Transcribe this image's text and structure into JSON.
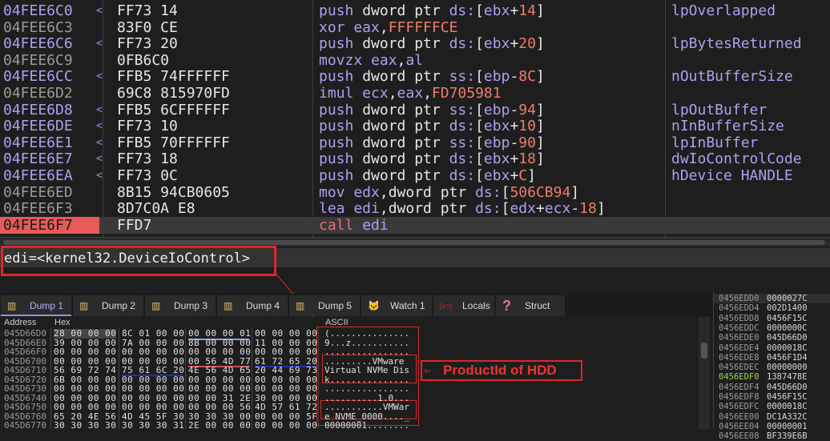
{
  "disasm": [
    {
      "addr": "04FEE6C0",
      "jt": true,
      "bytes": "FF73 14",
      "ins": [
        [
          "m",
          "push "
        ],
        [
          "w",
          "dword ptr "
        ],
        [
          "m",
          "ds:"
        ],
        [
          "w",
          "["
        ],
        [
          "m",
          "ebx"
        ],
        [
          "w",
          "+"
        ],
        [
          "n",
          "14"
        ],
        [
          "w",
          "]"
        ]
      ],
      "comment": "lpOverlapped"
    },
    {
      "addr": "04FEE6C3",
      "jt": false,
      "bytes": "83F0 CE",
      "ins": [
        [
          "m",
          "xor eax"
        ],
        [
          "w",
          ","
        ],
        [
          "n",
          "FFFFFFCE"
        ]
      ],
      "comment": ""
    },
    {
      "addr": "04FEE6C6",
      "jt": true,
      "bytes": "FF73 20",
      "ins": [
        [
          "m",
          "push "
        ],
        [
          "w",
          "dword ptr "
        ],
        [
          "m",
          "ds:"
        ],
        [
          "w",
          "["
        ],
        [
          "m",
          "ebx"
        ],
        [
          "w",
          "+"
        ],
        [
          "n",
          "20"
        ],
        [
          "w",
          "]"
        ]
      ],
      "comment": "lpBytesReturned"
    },
    {
      "addr": "04FEE6C9",
      "jt": false,
      "bytes": "0FB6C0",
      "ins": [
        [
          "m",
          "movzx eax"
        ],
        [
          "w",
          ","
        ],
        [
          "m",
          "al"
        ]
      ],
      "comment": ""
    },
    {
      "addr": "04FEE6CC",
      "jt": true,
      "bytes": "FFB5 74FFFFFF",
      "ins": [
        [
          "m",
          "push "
        ],
        [
          "w",
          "dword ptr "
        ],
        [
          "m",
          "ss:"
        ],
        [
          "w",
          "["
        ],
        [
          "m",
          "ebp"
        ],
        [
          "w",
          "-"
        ],
        [
          "n",
          "8C"
        ],
        [
          "w",
          "]"
        ]
      ],
      "comment": "nOutBufferSize"
    },
    {
      "addr": "04FEE6D2",
      "jt": false,
      "bytes": "69C8 815970FD",
      "ins": [
        [
          "m",
          "imul ecx"
        ],
        [
          "w",
          ","
        ],
        [
          "m",
          "eax"
        ],
        [
          "w",
          ","
        ],
        [
          "n",
          "FD705981"
        ]
      ],
      "comment": ""
    },
    {
      "addr": "04FEE6D8",
      "jt": true,
      "bytes": "FFB5 6CFFFFFF",
      "ins": [
        [
          "m",
          "push "
        ],
        [
          "w",
          "dword ptr "
        ],
        [
          "m",
          "ss:"
        ],
        [
          "w",
          "["
        ],
        [
          "m",
          "ebp"
        ],
        [
          "w",
          "-"
        ],
        [
          "n",
          "94"
        ],
        [
          "w",
          "]"
        ]
      ],
      "comment": "lpOutBuffer"
    },
    {
      "addr": "04FEE6DE",
      "jt": true,
      "bytes": "FF73 10",
      "ins": [
        [
          "m",
          "push "
        ],
        [
          "w",
          "dword ptr "
        ],
        [
          "m",
          "ds:"
        ],
        [
          "w",
          "["
        ],
        [
          "m",
          "ebx"
        ],
        [
          "w",
          "+"
        ],
        [
          "n",
          "10"
        ],
        [
          "w",
          "]"
        ]
      ],
      "comment": "nInBufferSize"
    },
    {
      "addr": "04FEE6E1",
      "jt": true,
      "bytes": "FFB5 70FFFFFF",
      "ins": [
        [
          "m",
          "push "
        ],
        [
          "w",
          "dword ptr "
        ],
        [
          "m",
          "ss:"
        ],
        [
          "w",
          "["
        ],
        [
          "m",
          "ebp"
        ],
        [
          "w",
          "-"
        ],
        [
          "n",
          "90"
        ],
        [
          "w",
          "]"
        ]
      ],
      "comment": "lpInBuffer"
    },
    {
      "addr": "04FEE6E7",
      "jt": true,
      "bytes": "FF73 18",
      "ins": [
        [
          "m",
          "push "
        ],
        [
          "w",
          "dword ptr "
        ],
        [
          "m",
          "ds:"
        ],
        [
          "w",
          "["
        ],
        [
          "m",
          "ebx"
        ],
        [
          "w",
          "+"
        ],
        [
          "n",
          "18"
        ],
        [
          "w",
          "]"
        ]
      ],
      "comment": "dwIoControlCode"
    },
    {
      "addr": "04FEE6EA",
      "jt": true,
      "bytes": "FF73 0C",
      "ins": [
        [
          "m",
          "push "
        ],
        [
          "w",
          "dword ptr "
        ],
        [
          "m",
          "ds:"
        ],
        [
          "w",
          "["
        ],
        [
          "m",
          "ebx"
        ],
        [
          "w",
          "+"
        ],
        [
          "n",
          "C"
        ],
        [
          "w",
          "]"
        ]
      ],
      "comment": "hDevice HANDLE"
    },
    {
      "addr": "04FEE6ED",
      "jt": false,
      "bytes": "8B15 94CB0605",
      "ins": [
        [
          "m",
          "mov edx"
        ],
        [
          "w",
          ",dword ptr "
        ],
        [
          "m",
          "ds:"
        ],
        [
          "w",
          "["
        ],
        [
          "n",
          "506CB94"
        ],
        [
          "w",
          "]"
        ]
      ],
      "comment": ""
    },
    {
      "addr": "04FEE6F3",
      "jt": false,
      "bytes": "8D7C0A E8",
      "ins": [
        [
          "m",
          "lea edi"
        ],
        [
          "w",
          ",dword ptr "
        ],
        [
          "m",
          "ds:"
        ],
        [
          "w",
          "["
        ],
        [
          "m",
          "edx"
        ],
        [
          "w",
          "+"
        ],
        [
          "m",
          "ecx"
        ],
        [
          "w",
          "-"
        ],
        [
          "n",
          "18"
        ],
        [
          "w",
          "]"
        ]
      ],
      "comment": ""
    },
    {
      "addr": "04FEE6F7",
      "jt": false,
      "current": true,
      "bytes": "FFD7",
      "ins": [
        [
          "c",
          "call "
        ],
        [
          "m",
          "edi"
        ]
      ],
      "comment": ""
    }
  ],
  "info": "edi=<kernel32.DeviceIoControl>",
  "tabs": [
    {
      "label": "Dump 1",
      "icon": "memory-icon",
      "glyph": "▥",
      "active": true
    },
    {
      "label": "Dump 2",
      "icon": "memory-icon",
      "glyph": "▥"
    },
    {
      "label": "Dump 3",
      "icon": "memory-icon",
      "glyph": "▥"
    },
    {
      "label": "Dump 4",
      "icon": "memory-icon",
      "glyph": "▥"
    },
    {
      "label": "Dump 5",
      "icon": "memory-icon",
      "glyph": "▥"
    },
    {
      "label": "Watch 1",
      "icon": "watch-icon",
      "glyph": "🐱"
    },
    {
      "label": "Locals",
      "icon": "locals-icon",
      "glyph": "[x=]"
    },
    {
      "label": "Struct",
      "icon": "struct-icon",
      "glyph": "?"
    }
  ],
  "dump": {
    "headers": {
      "address": "Address",
      "hex": "Hex",
      "ascii": "ASCII"
    },
    "rows": [
      {
        "addr": "045D66D0",
        "hex": [
          "28 00 00 00",
          "8C 01 00 00",
          "00 00 00 01",
          "00 00 00 00"
        ],
        "ascii": "(..............."
      },
      {
        "addr": "045D66E0",
        "hex": [
          "39 00 00 00",
          "7A 00 00 00",
          "8B 00 00 00",
          "11 00 00 00"
        ],
        "ascii": "9...z..........."
      },
      {
        "addr": "045D66F0",
        "hex": [
          "00 00 00 00",
          "00 00 00 00",
          "00 00 00 00",
          "00 00 00 00"
        ],
        "ascii": "................"
      },
      {
        "addr": "045D6700",
        "hex": [
          "00 00 00 00",
          "00 00 00 00",
          "00 56 4D 77",
          "61 72 65 20"
        ],
        "ascii": ".........VMware "
      },
      {
        "addr": "045D6710",
        "hex": [
          "56 69 72 74",
          "75 61 6C 20",
          "4E 56 4D 65",
          "20 44 69 73"
        ],
        "ascii": "Virtual NVMe Dis"
      },
      {
        "addr": "045D6720",
        "hex": [
          "6B 00 00 00",
          "00 00 00 00",
          "00 00 00 00",
          "00 00 00 00"
        ],
        "ascii": "k..............."
      },
      {
        "addr": "045D6730",
        "hex": [
          "00 00 00 00",
          "00 00 00 00",
          "00 00 00 00",
          "00 00 00 00"
        ],
        "ascii": "................"
      },
      {
        "addr": "045D6740",
        "hex": [
          "00 00 00 00",
          "00 00 00 00",
          "00 00 31 2E",
          "30 00 00 00"
        ],
        "ascii": "..........1.0..."
      },
      {
        "addr": "045D6750",
        "hex": [
          "00 00 00 00",
          "00 00 00 00",
          "00 00 00 56",
          "4D 57 61 72"
        ],
        "ascii": "...........VMWar"
      },
      {
        "addr": "045D6760",
        "hex": [
          "65 20 4E 56",
          "4D 45 5F 30",
          "30 30 30 00",
          "00 00 00 5F"
        ],
        "ascii": "e NVME_0000...._"
      },
      {
        "addr": "045D6770",
        "hex": [
          "30 30 30 30",
          "30 30 30 31",
          "2E 00 00 00",
          "00 00 00 00"
        ],
        "ascii": "00000001........"
      }
    ]
  },
  "stack": [
    [
      "0456EDD0",
      "0000027C"
    ],
    [
      "0456EDD4",
      "002D1400"
    ],
    [
      "0456EDD8",
      "0456F15C"
    ],
    [
      "0456EDDC",
      "0000000C"
    ],
    [
      "0456EDE0",
      "045D66D0"
    ],
    [
      "0456EDE4",
      "0000018C"
    ],
    [
      "0456EDE8",
      "0456F1D4"
    ],
    [
      "0456EDEC",
      "00000000"
    ],
    [
      "0456EDF0",
      "1387478E"
    ],
    [
      "0456EDF4",
      "045D66D0"
    ],
    [
      "0456EDF8",
      "0456F15C"
    ],
    [
      "0456EDFC",
      "0000018C"
    ],
    [
      "0456EE00",
      "DC1A332C"
    ],
    [
      "0456EE04",
      "00000001"
    ],
    [
      "0456EE08",
      "BF339E6B"
    ]
  ],
  "annotation": "ProductId of HDD",
  "colors": {
    "highlight": "#e0262b",
    "current_addr": "#e85a5a",
    "jump_target": "#b29ef0"
  }
}
